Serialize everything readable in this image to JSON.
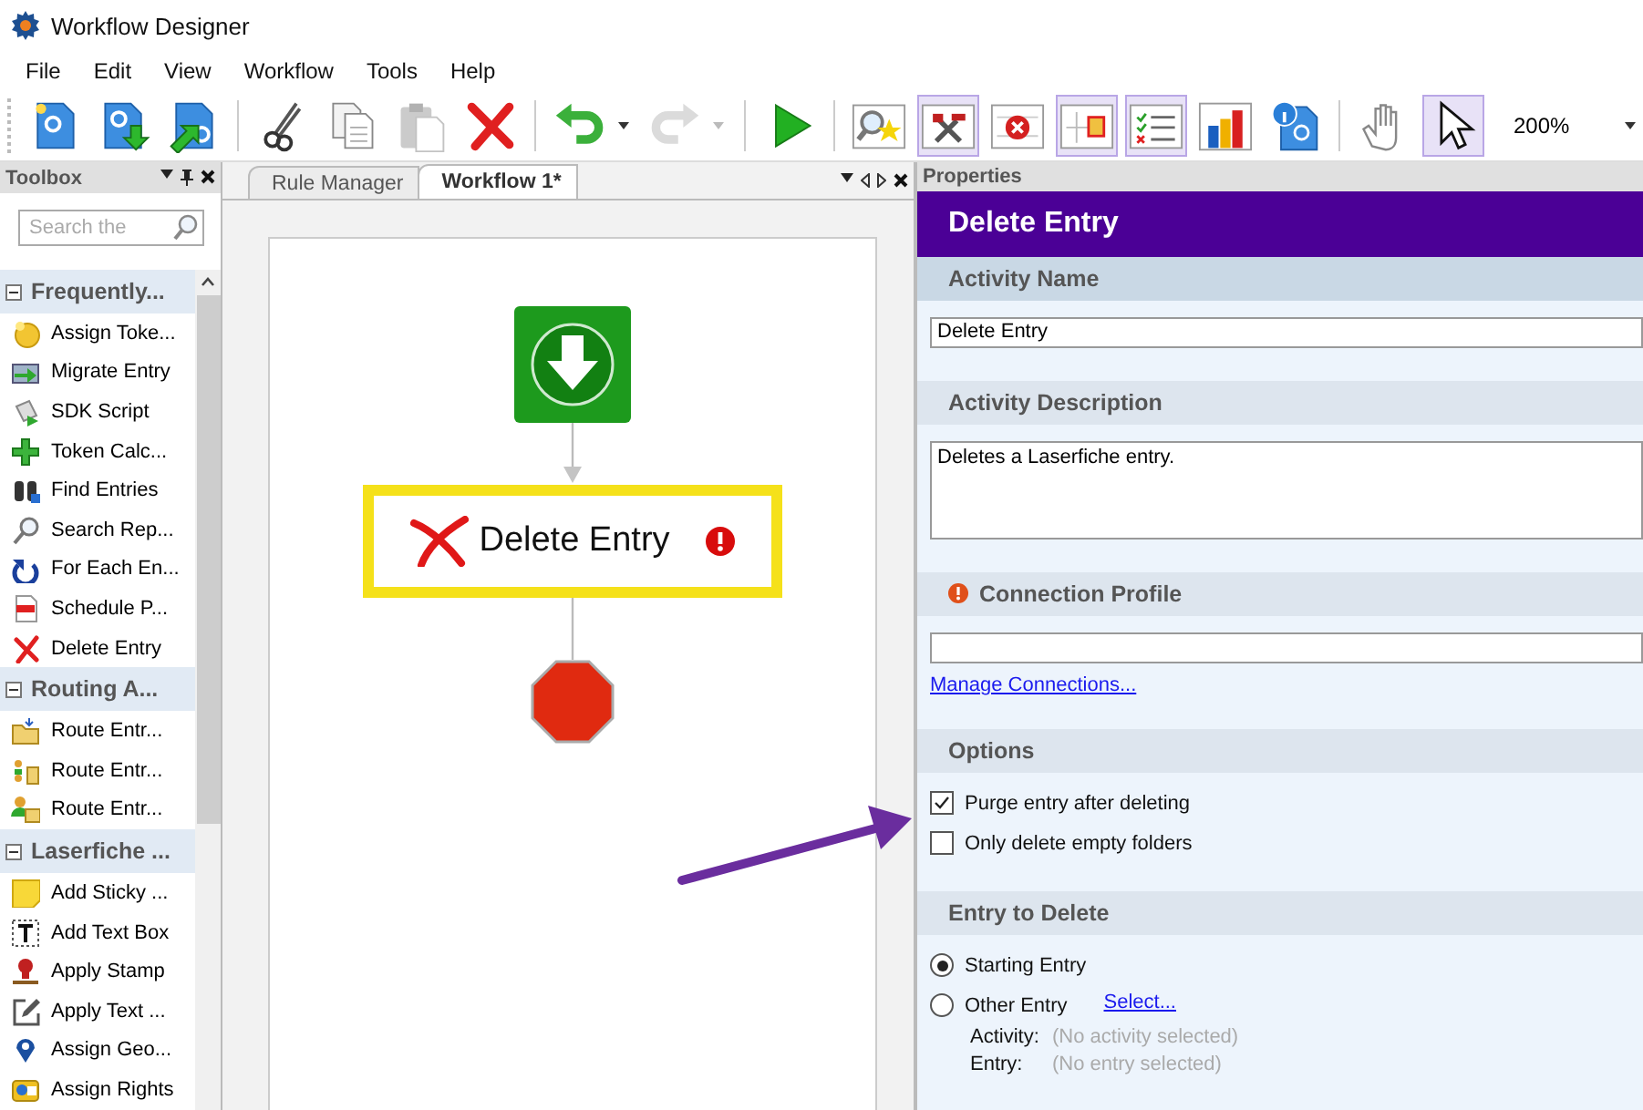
{
  "window": {
    "title": "Workflow Designer"
  },
  "menu": [
    "File",
    "Edit",
    "View",
    "Workflow",
    "Tools",
    "Help"
  ],
  "toolbar": [
    {
      "kind": "new",
      "selected": false,
      "disabled": false
    },
    {
      "kind": "import",
      "selected": false,
      "disabled": false
    },
    {
      "kind": "export",
      "selected": false,
      "disabled": false
    },
    {
      "kind": "sep"
    },
    {
      "kind": "cut",
      "selected": false,
      "disabled": false
    },
    {
      "kind": "copy",
      "selected": false,
      "disabled": false
    },
    {
      "kind": "paste",
      "selected": false,
      "disabled": true
    },
    {
      "kind": "delete",
      "selected": false,
      "disabled": false
    },
    {
      "kind": "sep"
    },
    {
      "kind": "undo",
      "selected": false,
      "disabled": false,
      "menu": true
    },
    {
      "kind": "redo",
      "selected": false,
      "disabled": true,
      "menu": true
    },
    {
      "kind": "sep"
    },
    {
      "kind": "run",
      "selected": false,
      "disabled": false
    },
    {
      "kind": "sep"
    },
    {
      "kind": "find",
      "selected": false,
      "disabled": false
    },
    {
      "kind": "tools",
      "selected": true,
      "disabled": false
    },
    {
      "kind": "error",
      "selected": false,
      "disabled": false
    },
    {
      "kind": "layout",
      "selected": true,
      "disabled": false
    },
    {
      "kind": "checklist",
      "selected": true,
      "disabled": false
    },
    {
      "kind": "chart",
      "selected": false,
      "disabled": false
    },
    {
      "kind": "info",
      "selected": false,
      "disabled": false
    },
    {
      "kind": "sep"
    },
    {
      "kind": "hand",
      "selected": false,
      "disabled": false
    },
    {
      "kind": "pointer",
      "selected": true,
      "disabled": false
    }
  ],
  "zoom": {
    "value": "200%"
  },
  "toolbox": {
    "title": "Toolbox",
    "search": {
      "placeholder": "Search the"
    },
    "groups": [
      {
        "title": "Frequently...",
        "expanded": true,
        "items": [
          {
            "kind": "token",
            "label": "Assign Toke..."
          },
          {
            "kind": "migrate",
            "label": "Migrate Entry"
          },
          {
            "kind": "script",
            "label": "SDK Script"
          },
          {
            "kind": "calc",
            "label": "Token Calc..."
          },
          {
            "kind": "find",
            "label": "Find Entries"
          },
          {
            "kind": "search",
            "label": "Search Rep..."
          },
          {
            "kind": "foreach",
            "label": "For Each En..."
          },
          {
            "kind": "pdf",
            "label": "Schedule P..."
          },
          {
            "kind": "delete",
            "label": "Delete Entry"
          }
        ]
      },
      {
        "title": "Routing A...",
        "expanded": true,
        "items": [
          {
            "kind": "folder",
            "label": "Route Entr..."
          },
          {
            "kind": "users",
            "label": "Route Entr..."
          },
          {
            "kind": "user",
            "label": "Route Entr..."
          }
        ]
      },
      {
        "title": "Laserfiche ...",
        "expanded": true,
        "items": [
          {
            "kind": "sticky",
            "label": "Add Sticky ..."
          },
          {
            "kind": "textbox",
            "label": "Add Text Box"
          },
          {
            "kind": "stamp",
            "label": "Apply Stamp"
          },
          {
            "kind": "edit",
            "label": "Apply Text ..."
          },
          {
            "kind": "geo",
            "label": "Assign Geo..."
          },
          {
            "kind": "rights",
            "label": "Assign Rights"
          }
        ]
      }
    ]
  },
  "tabs": [
    {
      "label": "Rule Manager",
      "selected": false
    },
    {
      "label": "Workflow 1*",
      "selected": true
    }
  ],
  "workflow": {
    "nodes": [
      {
        "kind": "start"
      },
      {
        "kind": "activity",
        "label": "Delete Entry",
        "selected": true,
        "error": true
      },
      {
        "kind": "end"
      }
    ]
  },
  "properties": {
    "title": "Properties",
    "heading": "Delete Entry",
    "sections": [
      {
        "kind": "text",
        "title": "Activity Name",
        "warning": false,
        "value": "Delete Entry"
      },
      {
        "kind": "textarea",
        "title": "Activity Description",
        "warning": false,
        "value": "Deletes a Laserfiche entry."
      },
      {
        "kind": "text",
        "title": "Connection Profile",
        "warning": true,
        "link": "Manage Connections..."
      },
      {
        "kind": "checks",
        "title": "Options",
        "warning": false,
        "options": [
          {
            "label": "Purge entry after deleting",
            "checked": true
          },
          {
            "label": "Only delete empty folders",
            "checked": false
          }
        ]
      },
      {
        "kind": "radios",
        "title": "Entry to Delete",
        "warning": false,
        "options": [
          {
            "label": "Starting Entry",
            "selected": true
          },
          {
            "label": "Other Entry",
            "selected": false,
            "link": "Select..."
          }
        ],
        "details": [
          {
            "label": "Activity:",
            "value": "(No activity selected)"
          },
          {
            "label": "Entry:",
            "value": "(No entry selected)"
          }
        ]
      }
    ]
  }
}
